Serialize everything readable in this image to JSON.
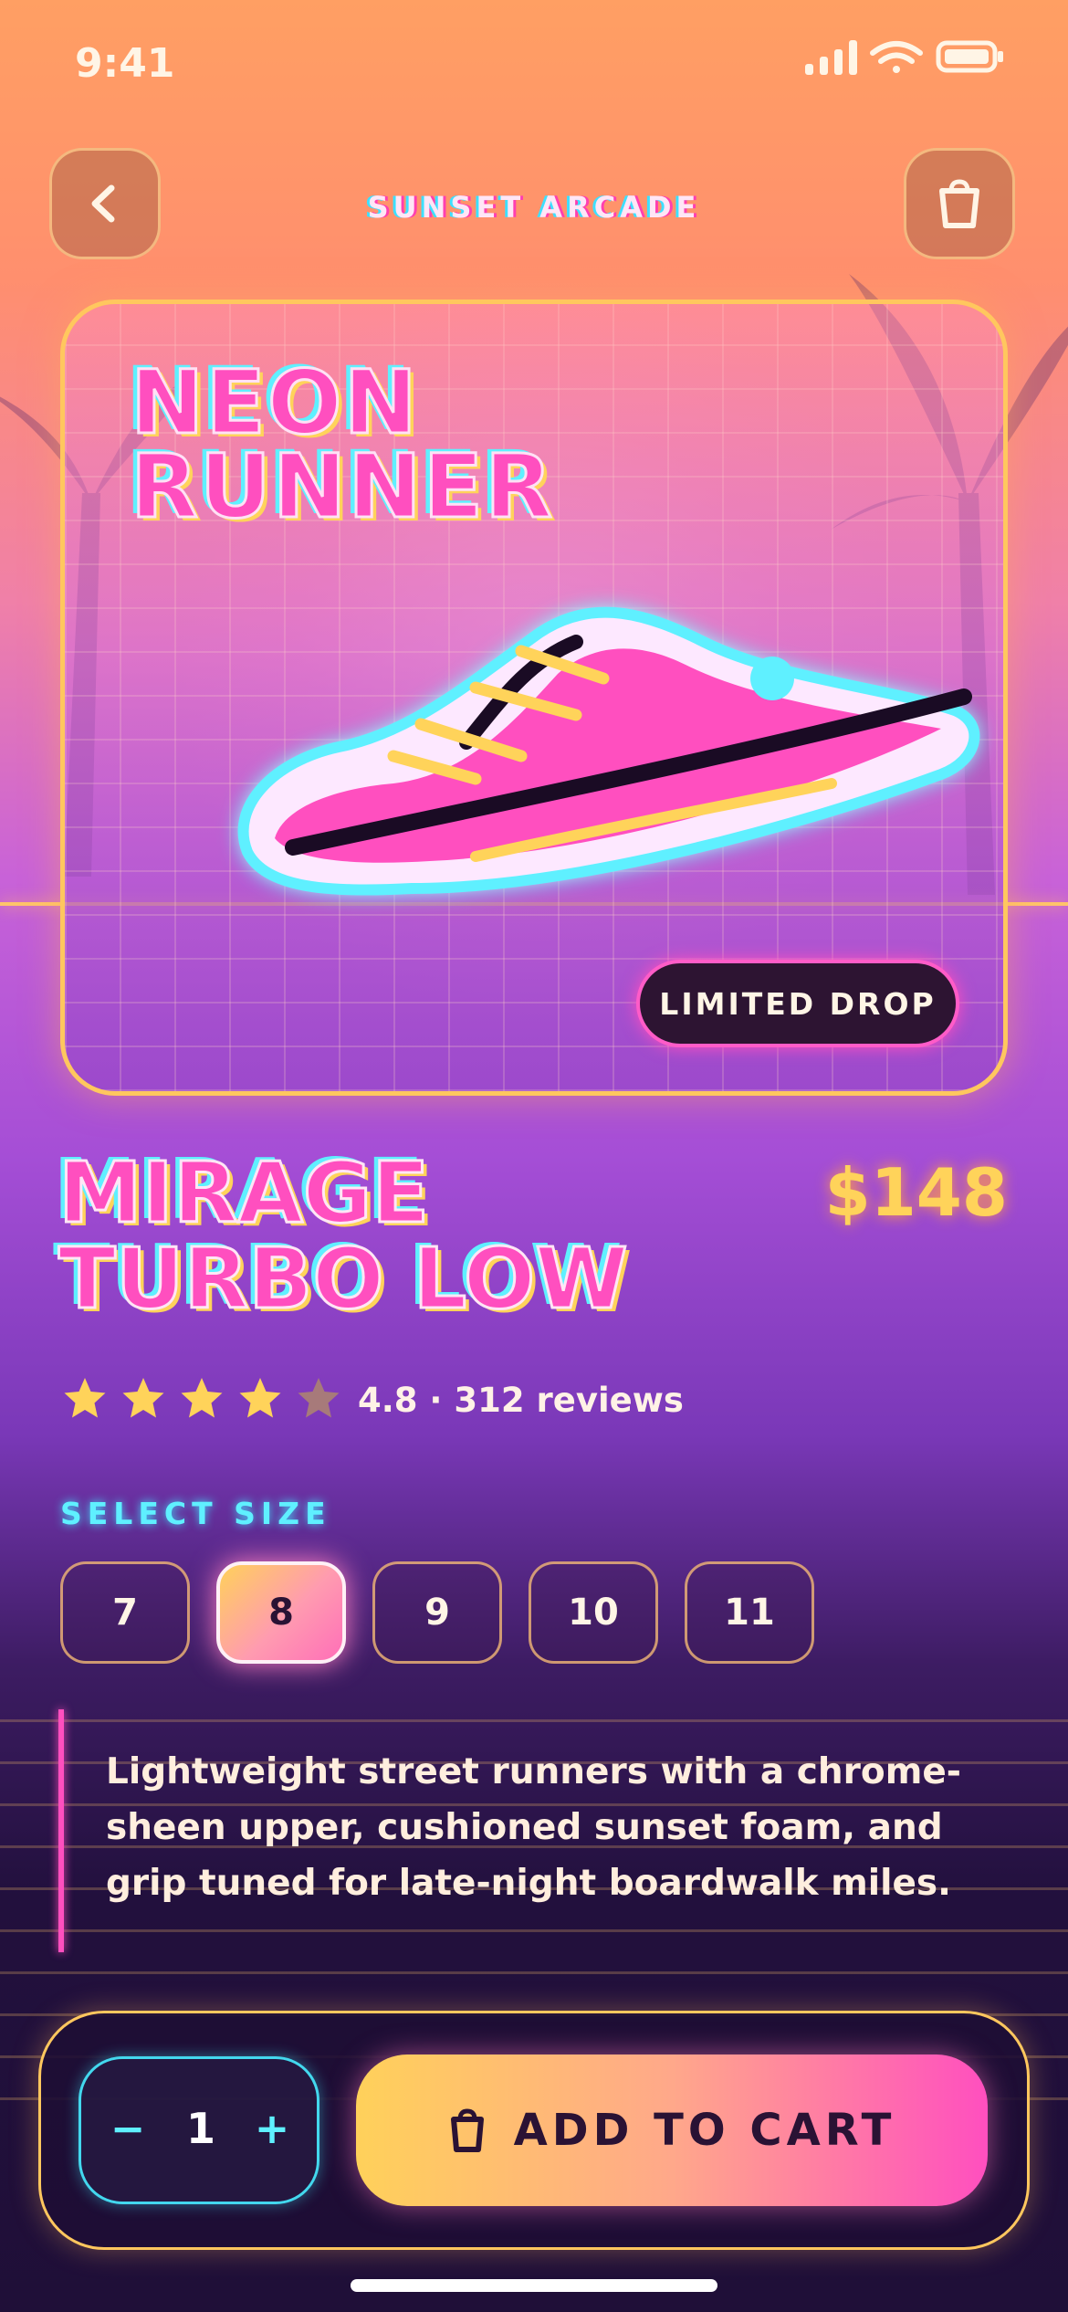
{
  "status_bar": {
    "time": "9:41",
    "icons": [
      "signal-icon",
      "wifi-icon",
      "battery-icon"
    ]
  },
  "header": {
    "brand": "SUNSET ARCADE",
    "back_icon": "chevron-left-icon",
    "bag_icon": "shopping-bag-icon"
  },
  "hero": {
    "title_line1": "NEON",
    "title_line2": "RUNNER",
    "badge": "LIMITED DROP"
  },
  "product": {
    "name_line1": "MIRAGE",
    "name_line2": "TURBO LOW",
    "price": "$148",
    "rating": 4,
    "rating_max": 5,
    "rating_text": "4.8 · 312 reviews",
    "size_label": "SELECT SIZE",
    "sizes": [
      "7",
      "8",
      "9",
      "10",
      "11"
    ],
    "selected_size": "8",
    "description": "Lightweight street runners with a chrome-sheen upper, cushioned sunset foam, and grip tuned for late-night boardwalk miles."
  },
  "cart": {
    "minus": "−",
    "quantity": "1",
    "plus": "+",
    "add_label": "ADD TO CART"
  },
  "colors": {
    "pink": "#ff4fbf",
    "cyan": "#5ff0ff",
    "gold": "#ffd35a",
    "dark": "#2a1234"
  }
}
